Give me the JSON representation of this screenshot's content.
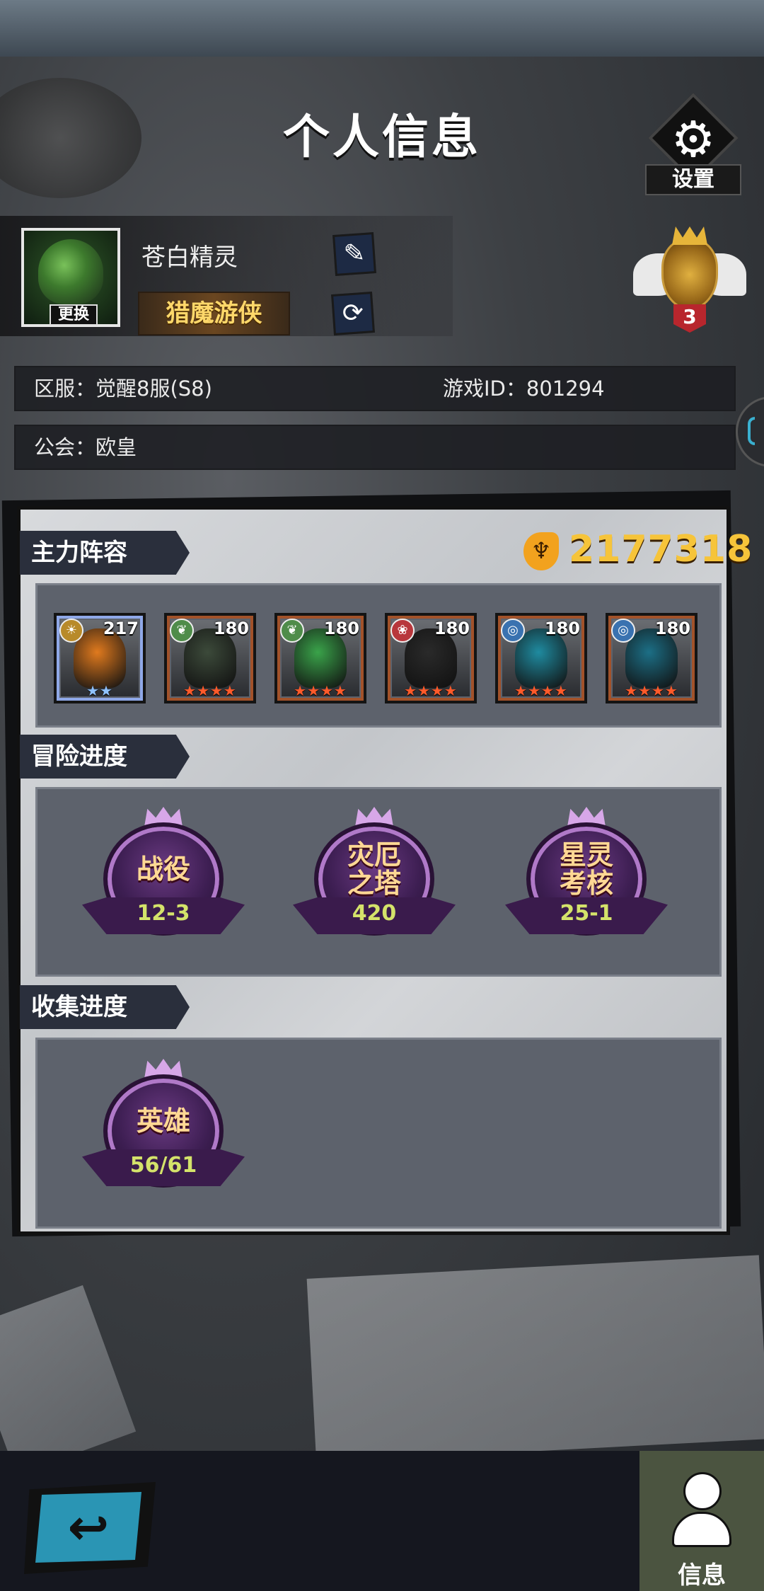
{
  "header": {
    "title": "个人信息",
    "settings_label": "设置",
    "settings_icon": "⚙"
  },
  "profile": {
    "avatar_change_label": "更换",
    "nickname": "苍白精灵",
    "title_badge": "猎魔游侠",
    "edit_icon": "✎",
    "swap_icon": "⟳",
    "rank_level": "3"
  },
  "info": {
    "server": "区服：觉醒8服(S8)",
    "game_id": "游戏ID：801294",
    "guild": "公会：欧皇"
  },
  "lineup": {
    "section_title": "主力阵容",
    "power_value": "2177318",
    "power_icon": "♆",
    "heroes": [
      {
        "level": "217",
        "element_icon": "☀",
        "stars": "★★",
        "elem_color": "#b88a2a",
        "frame_color": "#8fa8e8",
        "fig_color": "#e07a1e"
      },
      {
        "level": "180",
        "element_icon": "❦",
        "stars": "★★★★",
        "elem_color": "#4f8c4a",
        "frame_color": "#a2522a",
        "fig_color": "#3c4a3a"
      },
      {
        "level": "180",
        "element_icon": "❦",
        "stars": "★★★★",
        "elem_color": "#4f8c4a",
        "frame_color": "#a2522a",
        "fig_color": "#3aa34a"
      },
      {
        "level": "180",
        "element_icon": "❀",
        "stars": "★★★★",
        "elem_color": "#b8373c",
        "frame_color": "#a2522a",
        "fig_color": "#2a2a2a"
      },
      {
        "level": "180",
        "element_icon": "◎",
        "stars": "★★★★",
        "elem_color": "#3a72b0",
        "frame_color": "#a2522a",
        "fig_color": "#1f8ba0"
      },
      {
        "level": "180",
        "element_icon": "◎",
        "stars": "★★★★",
        "elem_color": "#3a72b0",
        "frame_color": "#a2522a",
        "fig_color": "#1c6f86"
      }
    ]
  },
  "adventure": {
    "section_title": "冒险进度",
    "items": [
      {
        "name": "战役",
        "value": "12-3"
      },
      {
        "name": "灾厄之塔",
        "value": "420"
      },
      {
        "name": "星灵考核",
        "value": "25-1"
      }
    ]
  },
  "collection": {
    "section_title": "收集进度",
    "items": [
      {
        "name": "英雄",
        "value": "56/61"
      }
    ]
  },
  "footer": {
    "back_icon": "↩",
    "info_label": "信息"
  }
}
